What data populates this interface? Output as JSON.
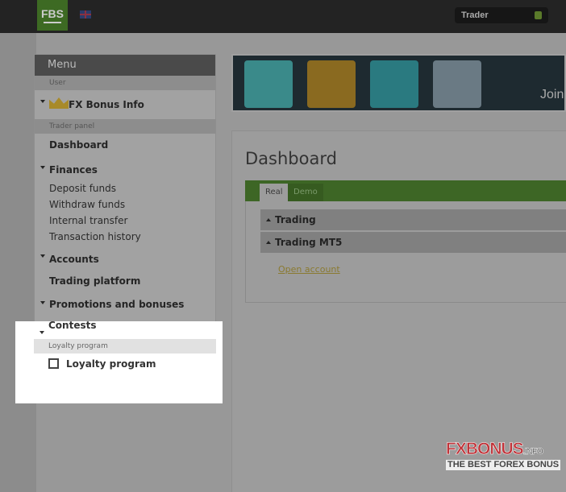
{
  "header": {
    "logo": "FBS",
    "account_type": "Trader",
    "flag": "uk-flag-icon"
  },
  "sidebar": {
    "title": "Menu",
    "sections": {
      "user": "User",
      "trader_panel": "Trader panel",
      "loyalty": "Loyalty program"
    },
    "fx_bonus": "FX Bonus Info",
    "dashboard": "Dashboard",
    "finances": "Finances",
    "finance_items": [
      "Deposit funds",
      "Withdraw funds",
      "Internal transfer",
      "Transaction history"
    ],
    "accounts": "Accounts",
    "trading_platform": "Trading platform",
    "promotions": "Promotions and bonuses",
    "contests": "Contests",
    "loyalty_program": "Loyalty program"
  },
  "banner": {
    "text": "Join"
  },
  "main": {
    "title": "Dashboard",
    "tabs": [
      "Real",
      "Demo"
    ],
    "active_tab": "Real",
    "sections": [
      "Trading",
      "Trading MT5"
    ],
    "open_account": "Open account"
  },
  "watermark": {
    "line1": "FXBONUS",
    "suffix": ".INFO",
    "line2": "THE BEST FOREX BONUS"
  }
}
